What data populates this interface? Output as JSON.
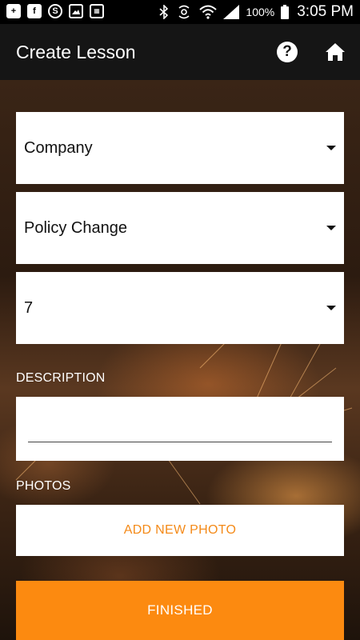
{
  "status_bar": {
    "notification_icons": [
      "add-notification-icon",
      "facebook-icon",
      "skype-icon",
      "image-icon",
      "calendar-icon"
    ],
    "system_icons": [
      "bluetooth-icon",
      "nfc-icon",
      "wifi-icon",
      "signal-icon",
      "battery-icon"
    ],
    "battery": "100%",
    "time": "3:05 PM"
  },
  "app_bar": {
    "title": "Create Lesson",
    "help_icon": "help-icon",
    "help_glyph": "?",
    "home_icon": "home-icon"
  },
  "form": {
    "category": {
      "selected": "Company"
    },
    "type": {
      "selected": "Policy Change"
    },
    "number": {
      "selected": "7"
    },
    "description": {
      "label": "DESCRIPTION",
      "value": ""
    },
    "photos": {
      "label": "PHOTOS",
      "add_label": "ADD NEW PHOTO"
    },
    "finished_label": "FINISHED"
  },
  "colors": {
    "accent": "#fc8a10",
    "add_photo_text": "#f48a18",
    "app_bar": "#151515",
    "status_bar": "#000000"
  }
}
